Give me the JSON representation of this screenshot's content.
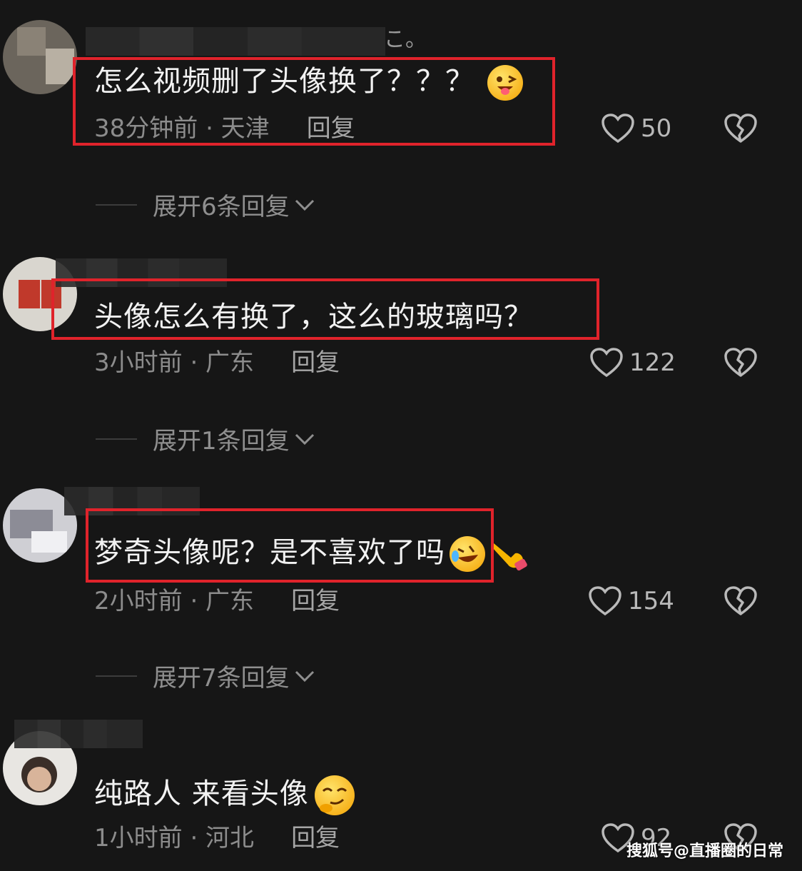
{
  "comments": [
    {
      "text": "怎么视频删了头像换了？？？",
      "time_location": "38分钟前 · 天津",
      "reply_label": "回复",
      "likes": "50",
      "expand_label": "展开6条回复",
      "username_fragment": "こ。"
    },
    {
      "text": "头像怎么有换了，这么的玻璃吗？",
      "time_location": "3小时前 · 广东",
      "reply_label": "回复",
      "likes": "122",
      "expand_label": "展开1条回复"
    },
    {
      "text": "梦奇头像呢？是不喜欢了吗",
      "time_location": "2小时前 · 广东",
      "reply_label": "回复",
      "likes": "154",
      "expand_label": "展开7条回复"
    },
    {
      "text": "纯路人 来看头像",
      "time_location": "1小时前 · 河北",
      "reply_label": "回复",
      "likes": "92"
    }
  ],
  "icons": {
    "like": "heart-outline-icon",
    "dislike": "broken-heart-icon",
    "expand": "chevron-down-icon"
  },
  "colors": {
    "background": "#161616",
    "highlight_box": "#e0232b",
    "meta_text": "#8c8c8c"
  },
  "watermark": "搜狐号@直播圈的日常"
}
